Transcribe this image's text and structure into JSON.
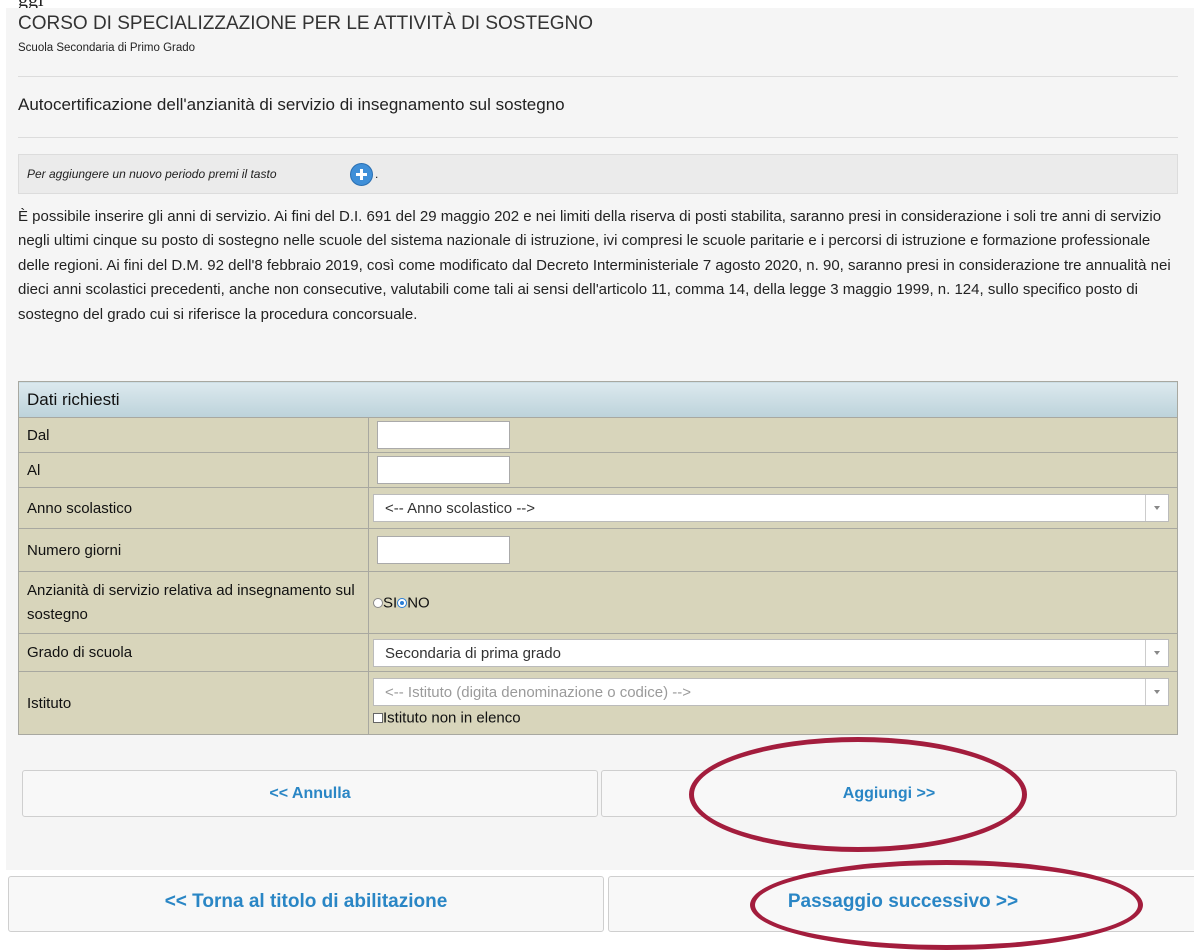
{
  "top_strip_text": "ggi",
  "header": {
    "course_title": "CORSO DI SPECIALIZZAZIONE PER LE ATTIVITÀ DI SOSTEGNO",
    "course_subtitle": "Scuola Secondaria di Primo Grado"
  },
  "section_title": "Autocertificazione dell'anzianità di servizio di insegnamento sul sostegno",
  "hint": {
    "text": "Per aggiungere un nuovo periodo premi il tasto",
    "suffix": ".",
    "icon": "plus-circle-icon"
  },
  "paragraph": "È possibile inserire gli anni di servizio. Ai fini del D.I. 691 del 29 maggio 202 e nei limiti della riserva di posti stabilita, saranno presi in considerazione i soli tre anni di servizio negli ultimi cinque su posto di sostegno nelle scuole del sistema nazionale di istruzione, ivi compresi le scuole paritarie e i percorsi di istruzione e formazione professionale delle regioni. Ai fini del D.M. 92 dell'8 febbraio 2019, così come modificato dal Decreto Interministeriale 7 agosto 2020, n. 90, saranno presi in considerazione tre annualità nei dieci anni scolastici precedenti, anche non consecutive, valutabili come tali ai sensi dell'articolo 11, comma 14, della legge 3 maggio 1999, n. 124, sullo specifico posto di sostegno del grado cui si riferisce la procedura concorsuale.",
  "form": {
    "heading": "Dati richiesti",
    "dal": {
      "label": "Dal",
      "value": ""
    },
    "al": {
      "label": "Al",
      "value": ""
    },
    "anno": {
      "label": "Anno scolastico",
      "value": "<-- Anno scolastico -->"
    },
    "giorni": {
      "label": "Numero giorni",
      "value": ""
    },
    "anzianita": {
      "label": "Anzianità di servizio relativa ad insegnamento sul sostegno",
      "options": [
        "SI",
        "NO"
      ],
      "selected": "NO"
    },
    "grado": {
      "label": "Grado di scuola",
      "value": "Secondaria di prima grado"
    },
    "istituto": {
      "label": "Istituto",
      "placeholder": "<-- Istituto (digita denominazione o codice) -->",
      "checkbox_label": "Istituto non in elenco",
      "checked": false
    }
  },
  "buttons": {
    "annulla": "<< Annulla",
    "aggiungi": "Aggiungi >>",
    "torna": "<< Torna al titolo di abilitazione",
    "successivo": "Passaggio successivo >>"
  },
  "colors": {
    "annotation_circle": "#a31d3d",
    "button_text": "#2a86c5",
    "row_background": "#d8d5bb"
  }
}
